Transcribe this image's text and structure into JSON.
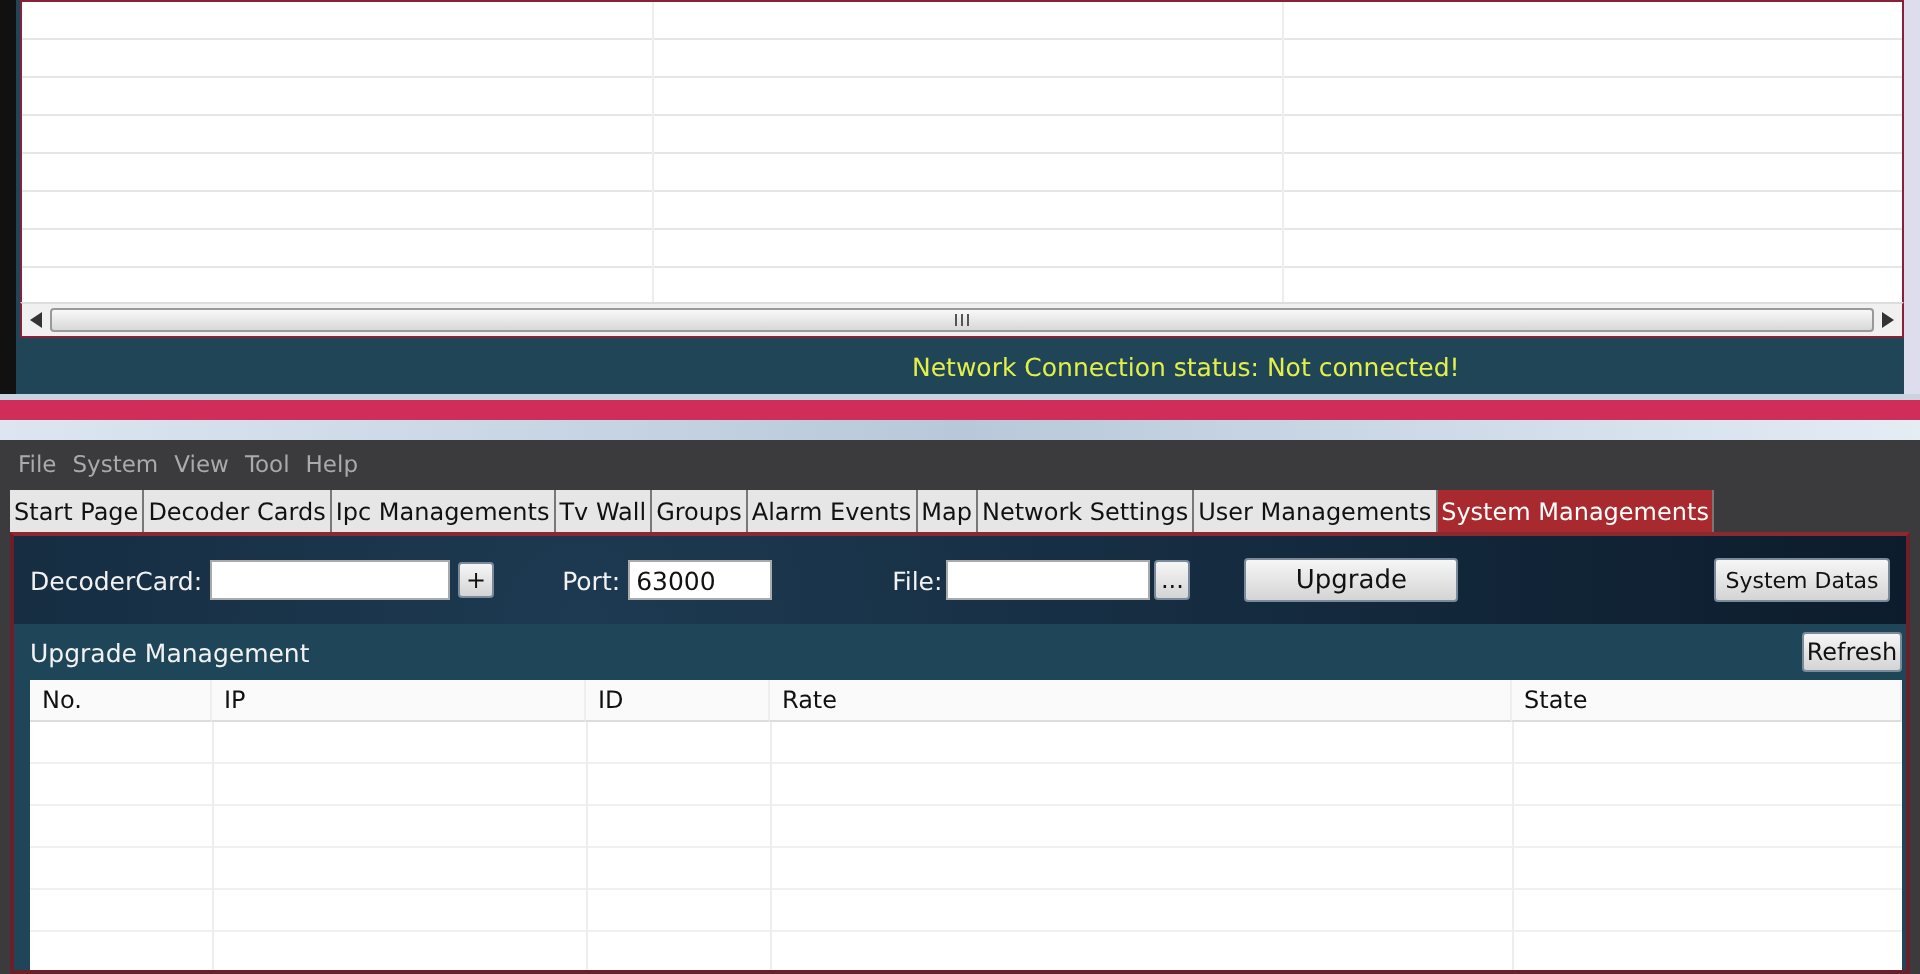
{
  "top_window": {
    "status": "Network Connection status: Not connected!"
  },
  "menu": [
    "File",
    "System",
    "View",
    "Tool",
    "Help"
  ],
  "tabs": [
    {
      "label": "Start Page",
      "selected": false
    },
    {
      "label": "Decoder Cards",
      "selected": false
    },
    {
      "label": "Ipc Managements",
      "selected": false
    },
    {
      "label": "Tv Wall",
      "selected": false
    },
    {
      "label": "Groups",
      "selected": false
    },
    {
      "label": "Alarm Events",
      "selected": false
    },
    {
      "label": "Map",
      "selected": false
    },
    {
      "label": "Network Settings",
      "selected": false
    },
    {
      "label": "User Managements",
      "selected": false
    },
    {
      "label": "System Managements",
      "selected": true
    }
  ],
  "toolbar": {
    "decoder_card_label": "DecoderCard:",
    "add_button": "+",
    "port_label": "Port:",
    "port_value": "63000",
    "file_label": "File:",
    "browse_button": "...",
    "upgrade_button": "Upgrade",
    "system_datas_button": "System Datas"
  },
  "upgrade_management": {
    "title": "Upgrade Management",
    "refresh_button": "Refresh",
    "columns": [
      "No.",
      "IP",
      "ID",
      "Rate",
      "State"
    ]
  }
}
